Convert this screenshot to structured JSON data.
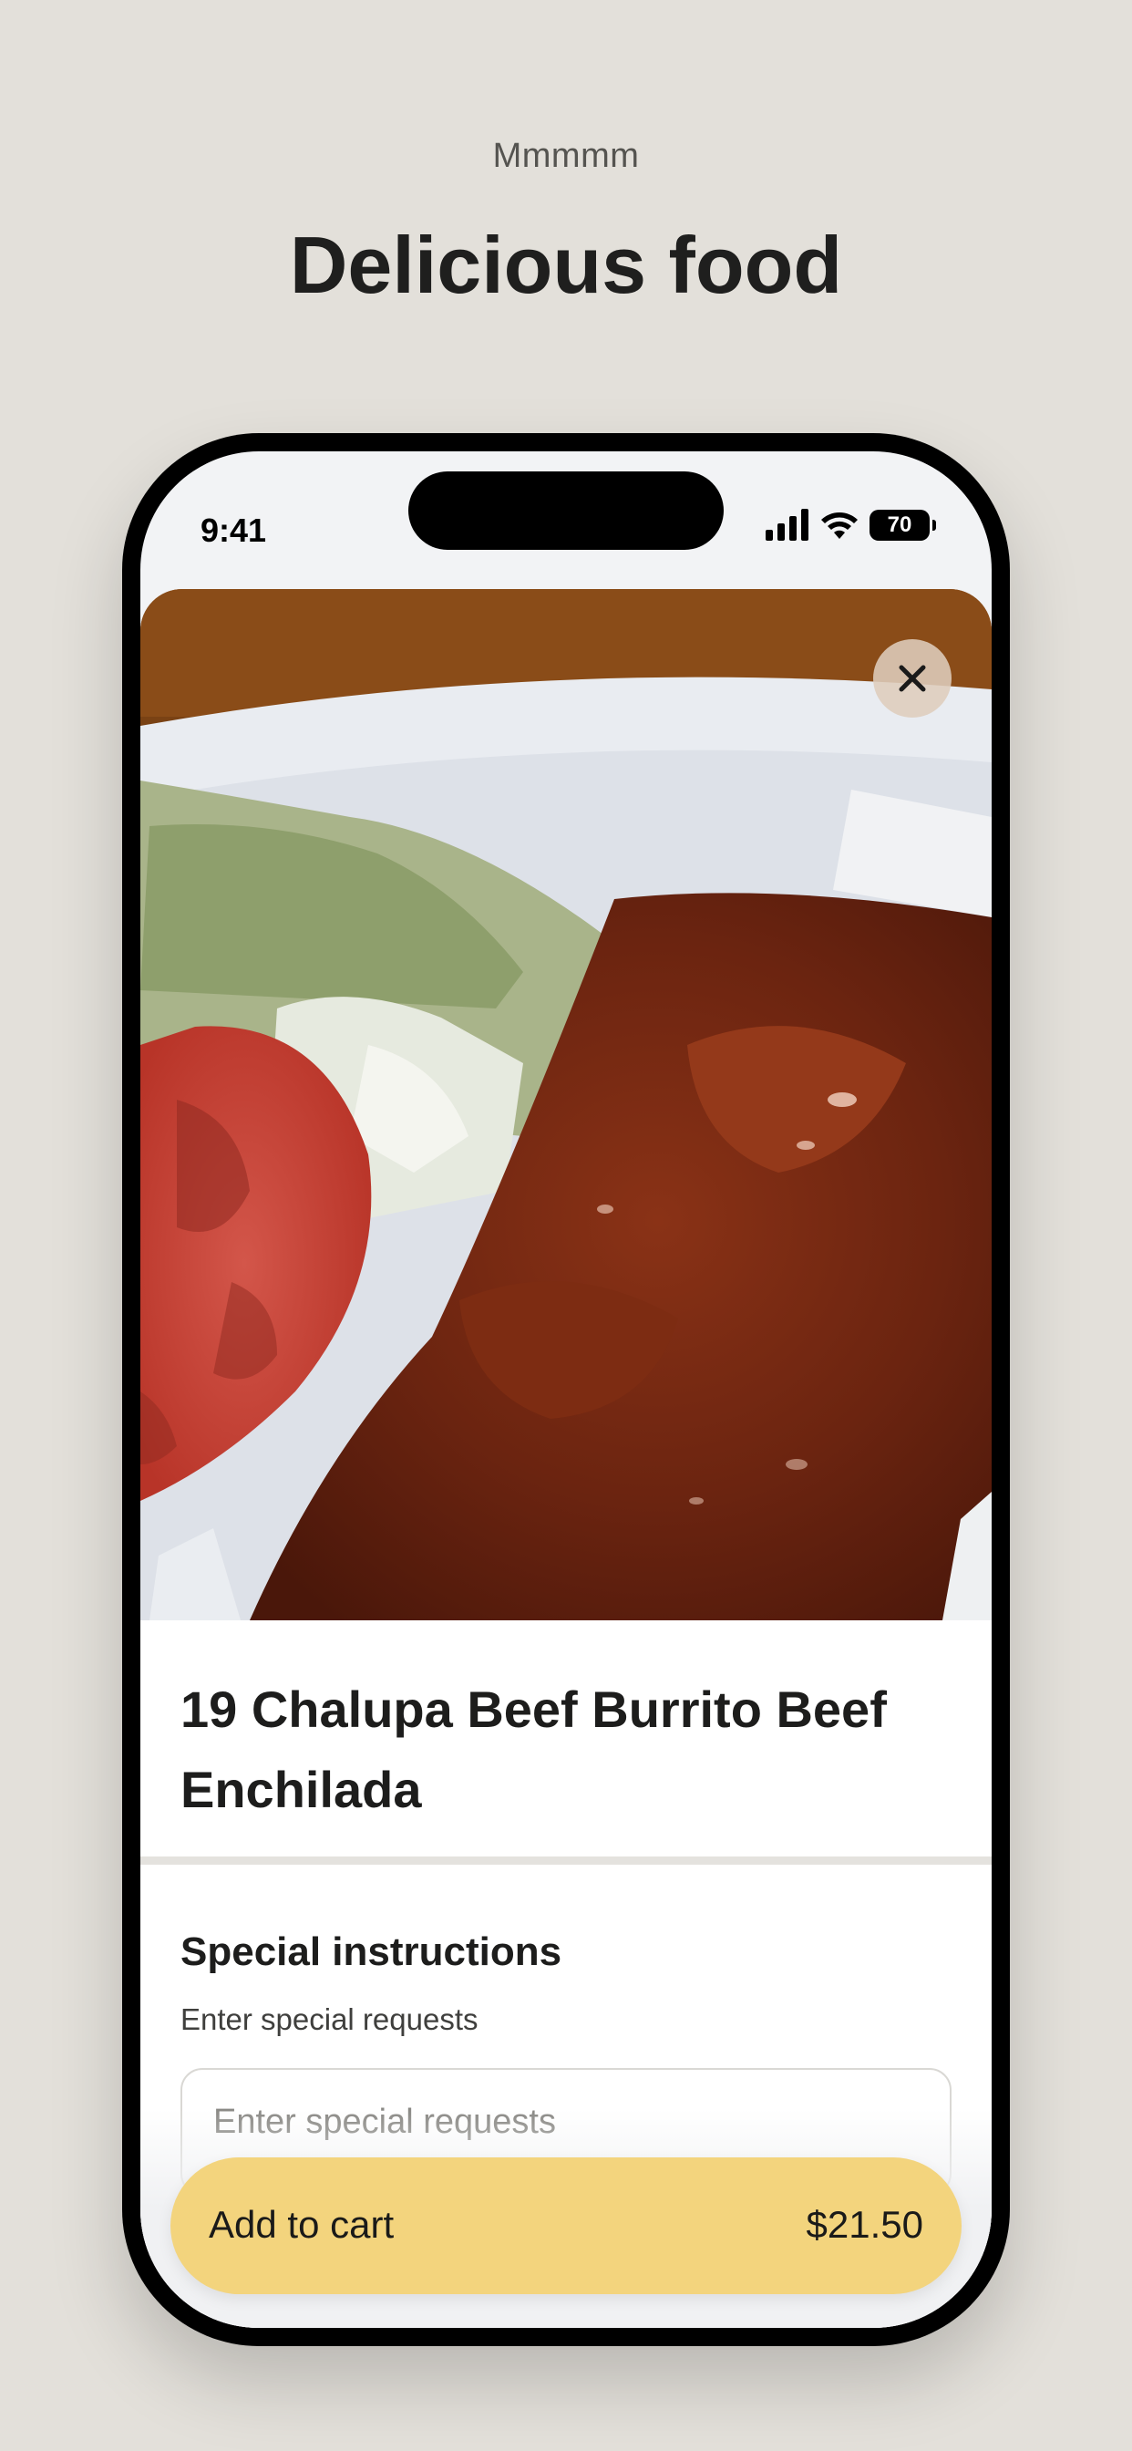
{
  "header": {
    "kicker": "Mmmmm",
    "headline": "Delicious food"
  },
  "status_bar": {
    "time": "9:41",
    "battery": "70",
    "icons": [
      "signal-icon",
      "wifi-icon",
      "battery-icon"
    ]
  },
  "item": {
    "title": "19 Chalupa Beef Burrito Beef Enchilada",
    "close_icon": "close-icon"
  },
  "special_instructions": {
    "title": "Special instructions",
    "subtitle": "Enter special requests",
    "placeholder": "Enter special requests"
  },
  "cart": {
    "label": "Add to cart",
    "price": "$21.50"
  },
  "colors": {
    "background": "#e3e0da",
    "button": "#f3d47d",
    "text": "#1d1d1c"
  }
}
